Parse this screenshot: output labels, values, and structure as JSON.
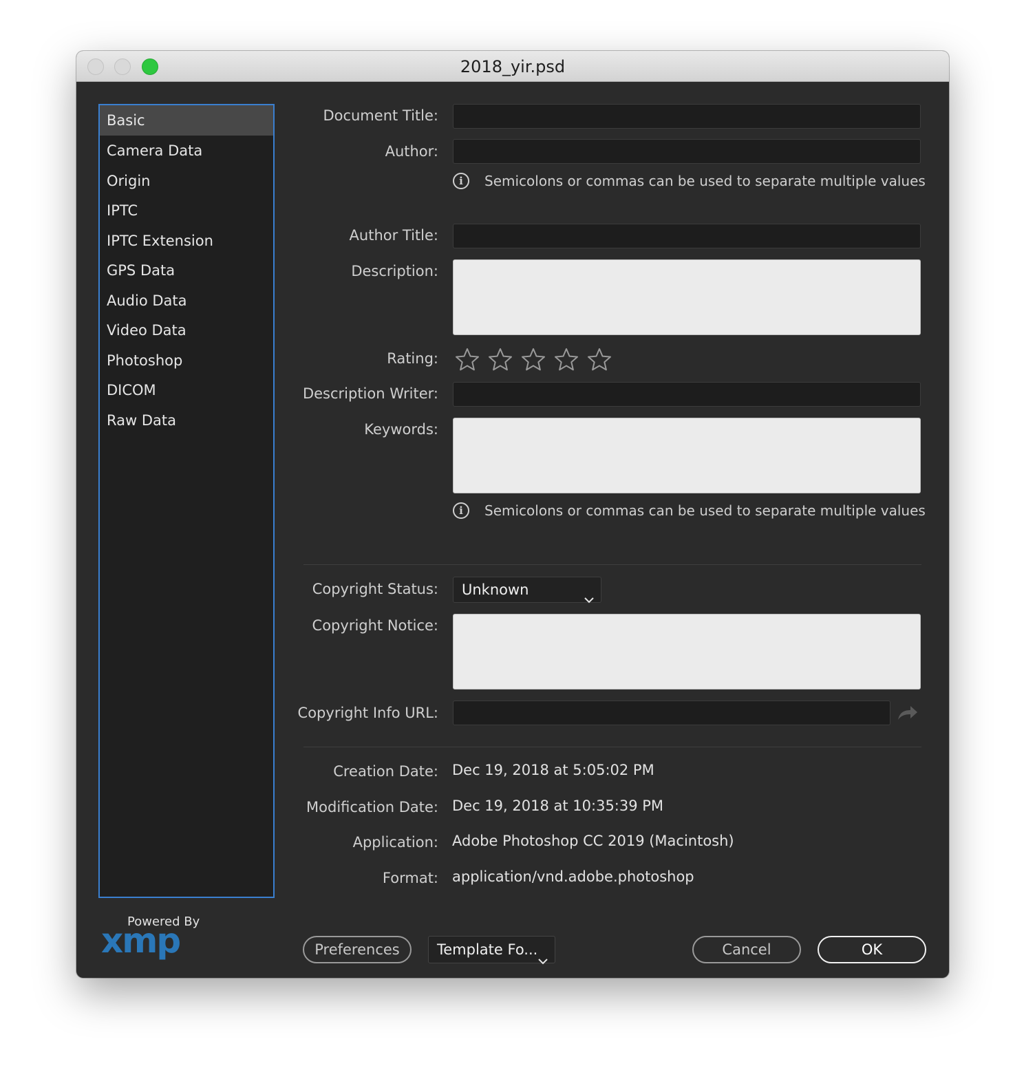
{
  "window": {
    "title": "2018_yir.psd"
  },
  "sidebar": {
    "items": [
      {
        "label": "Basic"
      },
      {
        "label": "Camera Data"
      },
      {
        "label": "Origin"
      },
      {
        "label": "IPTC"
      },
      {
        "label": "IPTC Extension"
      },
      {
        "label": "GPS Data"
      },
      {
        "label": "Audio Data"
      },
      {
        "label": "Video Data"
      },
      {
        "label": "Photoshop"
      },
      {
        "label": "DICOM"
      },
      {
        "label": "Raw Data"
      }
    ],
    "selected": "Basic"
  },
  "form": {
    "document_title_label": "Document Title:",
    "document_title_value": "",
    "author_label": "Author:",
    "author_value": "",
    "author_hint": "Semicolons or commas can be used to separate multiple values",
    "author_title_label": "Author Title:",
    "author_title_value": "",
    "description_label": "Description:",
    "description_value": "",
    "rating_label": "Rating:",
    "rating_value": 0,
    "rating_max": 5,
    "description_writer_label": "Description Writer:",
    "description_writer_value": "",
    "keywords_label": "Keywords:",
    "keywords_value": "",
    "keywords_hint": "Semicolons or commas can be used to separate multiple values",
    "copyright_status_label": "Copyright Status:",
    "copyright_status_value": "Unknown",
    "copyright_notice_label": "Copyright Notice:",
    "copyright_notice_value": "",
    "copyright_url_label": "Copyright Info URL:",
    "copyright_url_value": ""
  },
  "info": {
    "creation_date_label": "Creation Date:",
    "creation_date_value": "Dec 19, 2018 at 5:05:02 PM",
    "modification_date_label": "Modification Date:",
    "modification_date_value": "Dec 19, 2018 at 10:35:39 PM",
    "application_label": "Application:",
    "application_value": "Adobe Photoshop CC 2019 (Macintosh)",
    "format_label": "Format:",
    "format_value": "application/vnd.adobe.photoshop"
  },
  "footer": {
    "powered_by": "Powered By",
    "logo_text": "xmp",
    "preferences_label": "Preferences",
    "template_label": "Template Fo...",
    "cancel_label": "Cancel",
    "ok_label": "OK"
  },
  "colors": {
    "selection_border": "#3a7fd0",
    "logo_blue": "#2a77b8",
    "zoom_green": "#2ec840"
  }
}
